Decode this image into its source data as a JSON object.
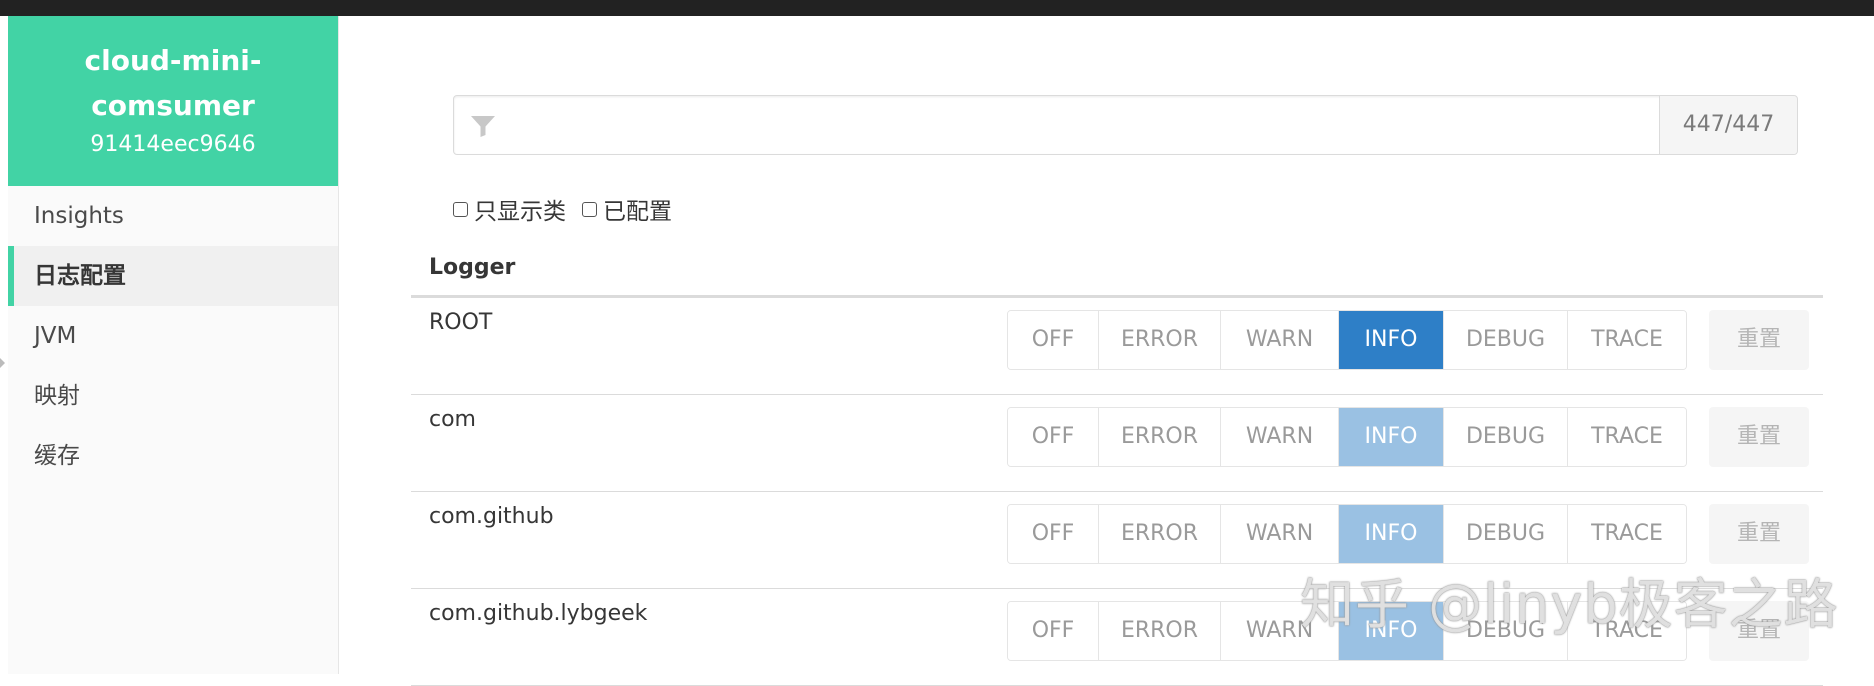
{
  "app": {
    "name": "cloud-mini-comsumer",
    "id": "91414eec9646"
  },
  "sidebar": {
    "items": [
      {
        "label": "Insights",
        "active": false
      },
      {
        "label": "日志配置",
        "active": true
      },
      {
        "label": "JVM",
        "active": false
      },
      {
        "label": "映射",
        "active": false
      },
      {
        "label": "缓存",
        "active": false
      }
    ]
  },
  "filter": {
    "placeholder": "",
    "count": "447/447",
    "icon": "filter-icon"
  },
  "options": {
    "classes_only_label": "只显示类",
    "configured_label": "已配置"
  },
  "table": {
    "header": "Logger",
    "levels": [
      "OFF",
      "ERROR",
      "WARN",
      "INFO",
      "DEBUG",
      "TRACE"
    ],
    "reset_label": "重置",
    "rows": [
      {
        "name": "ROOT",
        "level": "INFO",
        "configured": true
      },
      {
        "name": "com",
        "level": "INFO",
        "configured": false
      },
      {
        "name": "com.github",
        "level": "INFO",
        "configured": false
      },
      {
        "name": "com.github.lybgeek",
        "level": "INFO",
        "configured": false
      }
    ]
  },
  "colors": {
    "brand": "#42d3a5",
    "level_active": "#2e7fc7",
    "level_inherited": "#9ac1e3"
  },
  "watermark": "知乎 @linyb极客之路"
}
